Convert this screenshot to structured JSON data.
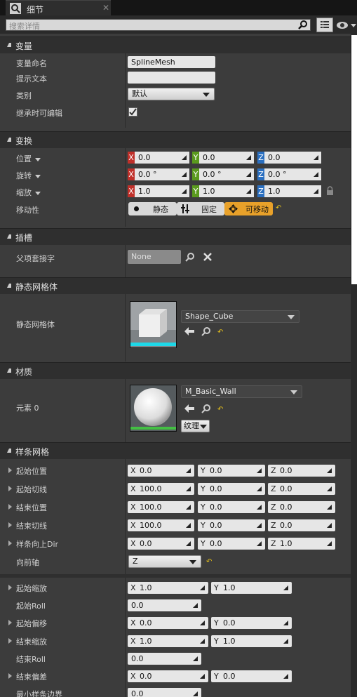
{
  "tab": {
    "title": "细节",
    "close": "✕"
  },
  "search": {
    "placeholder": "搜索详情"
  },
  "categories": {
    "variable": "变量",
    "transform": "变换",
    "sockets": "插槽",
    "static_mesh": "静态网格体",
    "materials": "材质",
    "spline_mesh": "样条网格"
  },
  "variable": {
    "name_label": "变量命名",
    "name_value": "SplineMesh",
    "tooltip_label": "提示文本",
    "tooltip_value": "",
    "category_label": "类别",
    "category_value": "默认",
    "editable_label": "继承时可编辑",
    "editable_checked": true
  },
  "transform": {
    "location_label": "位置",
    "rotation_label": "旋转",
    "scale_label": "缩放",
    "mobility_label": "移动性",
    "location": {
      "x": "0.0",
      "y": "0.0",
      "z": "0.0"
    },
    "rotation": {
      "x": "0.0 °",
      "y": "0.0 °",
      "z": "0.0 °"
    },
    "scale": {
      "x": "1.0",
      "y": "1.0",
      "z": "1.0"
    },
    "mobility": {
      "static": "静态",
      "stationary": "固定",
      "movable": "可移动",
      "selected": "movable"
    }
  },
  "sockets": {
    "parent_label": "父项套接字",
    "parent_value": "None"
  },
  "static_mesh": {
    "label": "静态网格体",
    "value": "Shape_Cube"
  },
  "materials": {
    "label": "元素 0",
    "value": "M_Basic_Wall",
    "textures": "纹理"
  },
  "spline": {
    "start_pos_label": "起始位置",
    "start_tan_label": "起始切线",
    "end_pos_label": "结束位置",
    "end_tan_label": "结束切线",
    "up_dir_label": "样条向上Dir",
    "forward_axis_label": "向前轴",
    "forward_axis_value": "Z",
    "start_pos": {
      "x": "0.0",
      "y": "0.0",
      "z": "0.0"
    },
    "start_tan": {
      "x": "100.0",
      "y": "0.0",
      "z": "0.0"
    },
    "end_pos": {
      "x": "100.0",
      "y": "0.0",
      "z": "0.0"
    },
    "end_tan": {
      "x": "100.0",
      "y": "0.0",
      "z": "0.0"
    },
    "up_dir": {
      "x": "0.0",
      "y": "0.0",
      "z": "1.0"
    },
    "start_scale_label": "起始缩放",
    "start_scale": {
      "x": "1.0",
      "y": "1.0"
    },
    "start_roll_label": "起始Roll",
    "start_roll": "0.0",
    "start_offset_label": "起始偏移",
    "start_offset": {
      "x": "0.0",
      "y": "0.0"
    },
    "end_scale_label": "结束缩放",
    "end_scale": {
      "x": "1.0",
      "y": "1.0"
    },
    "end_roll_label": "结束Roll",
    "end_roll": "0.0",
    "end_offset_label": "结束偏差",
    "end_offset": {
      "x": "0.0",
      "y": "0.0"
    },
    "min_bound_label": "最小样条边界",
    "min_bound": "0.0"
  },
  "axis_letters": {
    "x": "X",
    "y": "Y",
    "z": "Z"
  },
  "colors": {
    "x_axis": "#c0302a",
    "y_axis": "#5a9a1e",
    "z_axis": "#2a6fc0",
    "movable": "#e8a12a",
    "reset": "#e8c21a"
  }
}
